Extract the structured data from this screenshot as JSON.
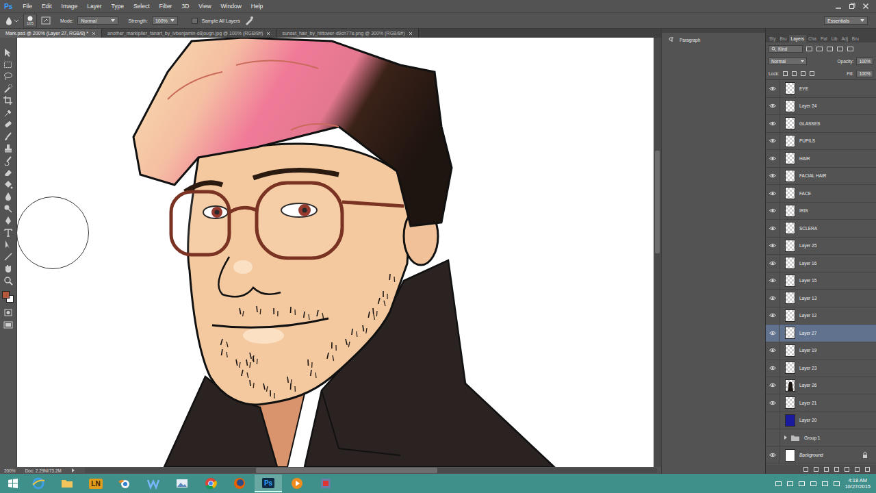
{
  "app": {
    "logo": "Ps",
    "menu": [
      "File",
      "Edit",
      "Image",
      "Layer",
      "Type",
      "Select",
      "Filter",
      "3D",
      "View",
      "Window",
      "Help"
    ]
  },
  "options": {
    "brush_size": "105",
    "mode_label": "Mode:",
    "mode": "Normal",
    "strength_label": "Strength:",
    "strength": "100%",
    "sample_all_layers": {
      "label": "Sample All Layers",
      "checked": false
    },
    "workspace": "Essentials"
  },
  "doc_tabs": [
    {
      "label": "Mark.psd @ 200% (Layer 27, RGB/8) *",
      "selected": true
    },
    {
      "label": "another_markiplier_fanart_by_ivbenjamin-d8jougn.jpg @ 100% (RGB/8#)",
      "selected": false
    },
    {
      "label": "sunset_hair_by_hittower-d9ch77e.png @ 300% (RGB/8#)",
      "selected": false
    }
  ],
  "swatches": {
    "foreground": "#b4593c",
    "background": "#ffffff"
  },
  "status_bar": {
    "zoom": "200%",
    "doc": "Doc: 2.29M/73.2M"
  },
  "paragraph_panel": {
    "items": [
      "Paragraph"
    ]
  },
  "layers_panel": {
    "tabs": [
      {
        "label": "Sty",
        "selected": false
      },
      {
        "label": "Bru",
        "selected": false
      },
      {
        "label": "Layers",
        "selected": true
      },
      {
        "label": "Cha",
        "selected": false
      },
      {
        "label": "Pat",
        "selected": false
      },
      {
        "label": "Lib",
        "selected": false
      },
      {
        "label": "Adj",
        "selected": false
      },
      {
        "label": "Bru",
        "selected": false
      }
    ],
    "filter": "Kind",
    "blend_mode": "Normal",
    "opacity_label": "Opacity:",
    "opacity": "100%",
    "lock_label": "Lock:",
    "fill_label": "Fill:",
    "fill": "100%",
    "layers": [
      {
        "name": "EYE",
        "visible": true,
        "selected": false,
        "locked": false,
        "kind": "empty"
      },
      {
        "name": "Layer 24",
        "visible": true,
        "selected": false,
        "locked": false,
        "kind": "empty"
      },
      {
        "name": "GLASSES",
        "visible": true,
        "selected": false,
        "locked": false,
        "kind": "empty"
      },
      {
        "name": "PUPILS",
        "visible": true,
        "selected": false,
        "locked": false,
        "kind": "empty"
      },
      {
        "name": "HAIR",
        "visible": true,
        "selected": false,
        "locked": false,
        "kind": "empty"
      },
      {
        "name": "FACIAL HAIR",
        "visible": true,
        "selected": false,
        "locked": false,
        "kind": "empty"
      },
      {
        "name": "FACE",
        "visible": true,
        "selected": false,
        "locked": false,
        "kind": "empty"
      },
      {
        "name": "IRIS",
        "visible": true,
        "selected": false,
        "locked": false,
        "kind": "empty"
      },
      {
        "name": "SCLERA",
        "visible": true,
        "selected": false,
        "locked": false,
        "kind": "empty"
      },
      {
        "name": "Layer 25",
        "visible": true,
        "selected": false,
        "locked": false,
        "kind": "empty"
      },
      {
        "name": "Layer 16",
        "visible": true,
        "selected": false,
        "locked": false,
        "kind": "empty"
      },
      {
        "name": "Layer 15",
        "visible": true,
        "selected": false,
        "locked": false,
        "kind": "empty"
      },
      {
        "name": "Layer 13",
        "visible": true,
        "selected": false,
        "locked": false,
        "kind": "empty"
      },
      {
        "name": "Layer 12",
        "visible": true,
        "selected": false,
        "locked": false,
        "kind": "empty"
      },
      {
        "name": "Layer 27",
        "visible": true,
        "selected": true,
        "locked": false,
        "kind": "empty"
      },
      {
        "name": "Layer 19",
        "visible": true,
        "selected": false,
        "locked": false,
        "kind": "empty"
      },
      {
        "name": "Layer 23",
        "visible": true,
        "selected": false,
        "locked": false,
        "kind": "empty"
      },
      {
        "name": "Layer 26",
        "visible": true,
        "selected": false,
        "locked": false,
        "kind": "figure"
      },
      {
        "name": "Layer 21",
        "visible": true,
        "selected": false,
        "locked": false,
        "kind": "empty"
      },
      {
        "name": "Layer 20",
        "visible": false,
        "selected": false,
        "locked": false,
        "kind": "fill",
        "color": "#1a1a9e"
      },
      {
        "name": "Group 1",
        "visible": false,
        "selected": false,
        "locked": false,
        "kind": "group",
        "expanded": false
      },
      {
        "name": "Background",
        "visible": true,
        "selected": false,
        "locked": true,
        "kind": "white"
      }
    ]
  },
  "taskbar": {
    "apps": [
      {
        "kind": "ie",
        "active": false
      },
      {
        "kind": "folder",
        "active": false
      },
      {
        "kind": "text",
        "label": "LN",
        "active": false
      },
      {
        "kind": "blender",
        "active": false
      },
      {
        "kind": "wunder",
        "active": false
      },
      {
        "kind": "picture",
        "active": false
      },
      {
        "kind": "chrome",
        "active": false
      },
      {
        "kind": "firefox",
        "active": false
      },
      {
        "kind": "text",
        "label": "Ps",
        "active": true
      },
      {
        "kind": "media",
        "active": false
      },
      {
        "kind": "tool",
        "active": false
      }
    ],
    "time": "4:18 AM",
    "date": "10/27/2015"
  }
}
